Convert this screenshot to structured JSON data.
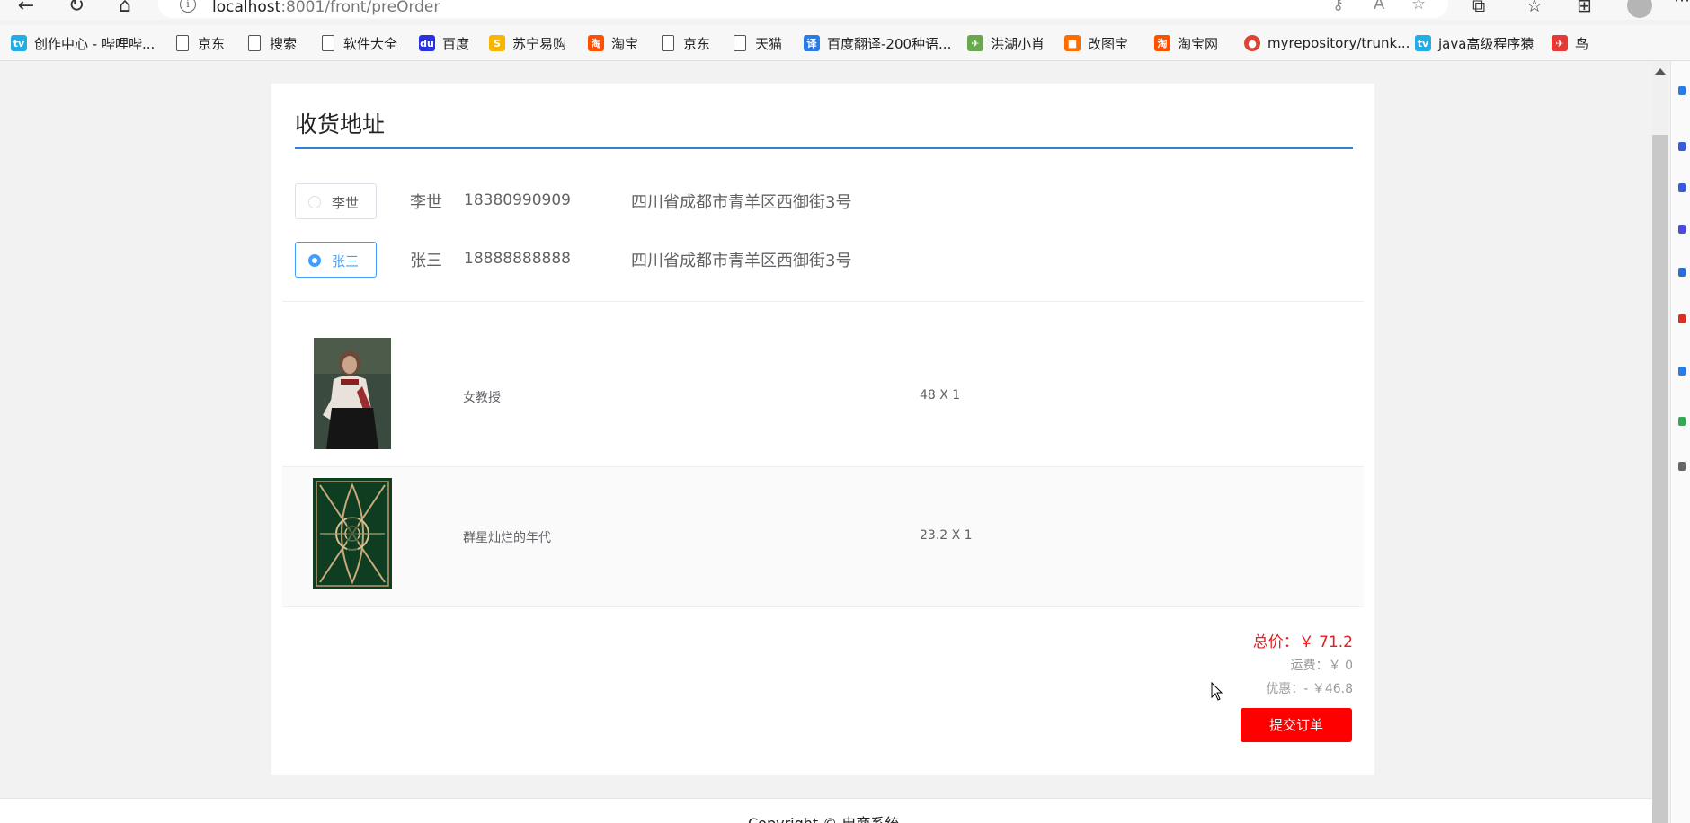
{
  "browser": {
    "url_host": "localhost",
    "url_rest": ":8001/front/preOrder",
    "nav": {
      "back": "←",
      "refresh": "↻",
      "home": "⌂"
    }
  },
  "bookmarks": [
    {
      "label": "创作中心 - 哔哩哔...",
      "icon": "bilibili-icon",
      "color": "#23ade5"
    },
    {
      "label": "京东",
      "icon": "page-icon"
    },
    {
      "label": "搜索",
      "icon": "page-icon"
    },
    {
      "label": "软件大全",
      "icon": "page-icon"
    },
    {
      "label": "百度",
      "icon": "baidu-icon",
      "color": "#2932e1"
    },
    {
      "label": "苏宁易购",
      "icon": "suning-icon",
      "color": "#f7b500"
    },
    {
      "label": "淘宝",
      "icon": "taobao-icon",
      "color": "#ff5000"
    },
    {
      "label": "京东",
      "icon": "page-icon"
    },
    {
      "label": "天猫",
      "icon": "page-icon"
    },
    {
      "label": "百度翻译-200种语...",
      "icon": "translate-icon",
      "color": "#2a7be4"
    },
    {
      "label": "洪湖小肖",
      "icon": "bird-icon",
      "color": "#6aa84f"
    },
    {
      "label": "改图宝",
      "icon": "gaitubao-icon",
      "color": "#ff6d00"
    },
    {
      "label": "淘宝网",
      "icon": "taobao-icon",
      "color": "#ff5000"
    },
    {
      "label": "myrepository/trunk...",
      "icon": "chrome-icon",
      "color": "#db4437"
    },
    {
      "label": "java高级程序猿",
      "icon": "bilibili-icon",
      "color": "#23ade5"
    },
    {
      "label": "鸟",
      "icon": "bird-icon",
      "color": "#e53935"
    }
  ],
  "page": {
    "section_title": "收货地址",
    "addresses": [
      {
        "radio_label": "李世",
        "name": "李世",
        "phone": "18380990909",
        "address": "四川省成都市青羊区西御街3号",
        "checked": false
      },
      {
        "radio_label": "张三",
        "name": "张三",
        "phone": "18888888888",
        "address": "四川省成都市青羊区西御街3号",
        "checked": true
      }
    ],
    "items": [
      {
        "title": "女教授",
        "qty": "48 X 1",
        "cover": "cover-woman"
      },
      {
        "title": "群星灿烂的年代",
        "qty": "23.2 X 1",
        "cover": "cover-green"
      }
    ],
    "total": "总价：￥ 71.2",
    "shipping": "运费：￥ 0",
    "discount": "优惠：- ￥46.8",
    "submit_label": "提交订单",
    "copyright": "Copyright © 电商系统"
  }
}
